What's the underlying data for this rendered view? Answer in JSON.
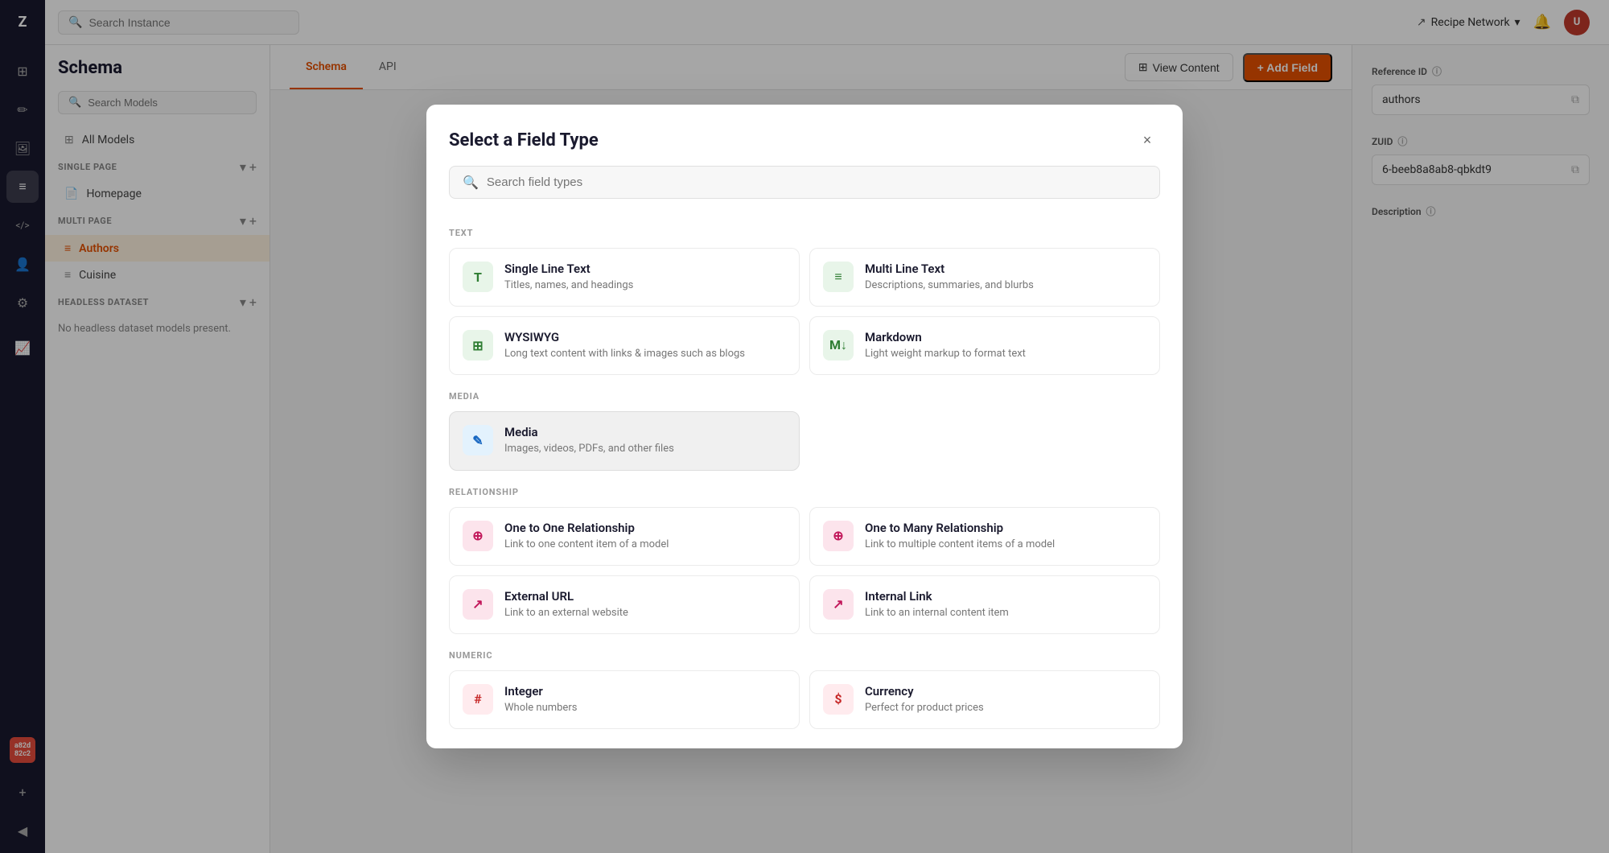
{
  "app": {
    "name": "Recipe Network",
    "logo_text": "Z"
  },
  "topbar": {
    "search_placeholder": "Search Instance",
    "recipe_network_label": "Recipe Network",
    "avatar_initials": "U"
  },
  "sidebar": {
    "schema_title": "Schema",
    "search_placeholder": "Search Models",
    "all_models_label": "All Models",
    "sections": [
      {
        "id": "single-page",
        "label": "SINGLE PAGE",
        "items": [
          {
            "id": "homepage",
            "label": "Homepage",
            "icon": "📄"
          }
        ]
      },
      {
        "id": "multi-page",
        "label": "MULTI PAGE",
        "items": [
          {
            "id": "authors",
            "label": "Authors",
            "icon": "≡",
            "active": true
          },
          {
            "id": "cuisine",
            "label": "Cuisine",
            "icon": "≡"
          }
        ]
      },
      {
        "id": "headless-dataset",
        "label": "HEADLESS DATASET",
        "items": [],
        "empty_message": "No headless dataset models present."
      }
    ]
  },
  "content_header": {
    "tabs": [
      {
        "id": "schema",
        "label": "Schema",
        "active": true
      },
      {
        "id": "api",
        "label": "API"
      }
    ],
    "view_content_label": "View Content",
    "add_field_label": "+ Add Field"
  },
  "right_panel": {
    "reference_id_label": "Reference ID",
    "reference_id_help": "?",
    "reference_id_value": "authors",
    "zuid_label": "ZUID",
    "zuid_help": "?",
    "zuid_value": "6-beeb8a8ab8-qbkdt9",
    "description_label": "Description",
    "description_help": "?"
  },
  "modal": {
    "title": "Select a Field Type",
    "search_placeholder": "Search field types",
    "close_label": "×",
    "sections": [
      {
        "id": "text",
        "label": "TEXT",
        "fields": [
          {
            "id": "single-line-text",
            "name": "Single Line Text",
            "desc": "Titles, names, and headings",
            "icon_text": "T",
            "icon_class": "green"
          },
          {
            "id": "multi-line-text",
            "name": "Multi Line Text",
            "desc": "Descriptions, summaries, and blurbs",
            "icon_text": "≡",
            "icon_class": "green"
          },
          {
            "id": "wysiwyg",
            "name": "WYSIWYG",
            "desc": "Long text content with links & images such as blogs",
            "icon_text": "⊞",
            "icon_class": "green"
          },
          {
            "id": "markdown",
            "name": "Markdown",
            "desc": "Light weight markup to format text",
            "icon_text": "M↓",
            "icon_class": "green"
          }
        ]
      },
      {
        "id": "media",
        "label": "MEDIA",
        "fields": [
          {
            "id": "media",
            "name": "Media",
            "desc": "Images, videos, PDFs, and other files",
            "icon_text": "✎",
            "icon_class": "blue",
            "highlighted": true
          }
        ]
      },
      {
        "id": "relationship",
        "label": "RELATIONSHIP",
        "fields": [
          {
            "id": "one-to-one",
            "name": "One to One Relationship",
            "desc": "Link to one content item of a model",
            "icon_text": "⊕",
            "icon_class": "pink"
          },
          {
            "id": "one-to-many",
            "name": "One to Many Relationship",
            "desc": "Link to multiple content items of a model",
            "icon_text": "⊕",
            "icon_class": "pink"
          },
          {
            "id": "external-url",
            "name": "External URL",
            "desc": "Link to an external website",
            "icon_text": "↗",
            "icon_class": "pink"
          },
          {
            "id": "internal-link",
            "name": "Internal Link",
            "desc": "Link to an internal content item",
            "icon_text": "↗",
            "icon_class": "pink"
          }
        ]
      },
      {
        "id": "numeric",
        "label": "NUMERIC",
        "fields": [
          {
            "id": "integer",
            "name": "Integer",
            "desc": "Whole numbers",
            "icon_text": "#",
            "icon_class": "red"
          },
          {
            "id": "currency",
            "name": "Currency",
            "desc": "Perfect for product prices",
            "icon_text": "$",
            "icon_class": "red"
          }
        ]
      }
    ]
  },
  "nav_icons": [
    {
      "id": "dashboard",
      "symbol": "⊞",
      "active": false
    },
    {
      "id": "content",
      "symbol": "✏",
      "active": false
    },
    {
      "id": "media",
      "symbol": "🖼",
      "active": false
    },
    {
      "id": "schema",
      "symbol": "≡",
      "active": true
    },
    {
      "id": "code",
      "symbol": "</>",
      "active": false
    },
    {
      "id": "users",
      "symbol": "👤",
      "active": false
    },
    {
      "id": "settings",
      "symbol": "⚙",
      "active": false
    },
    {
      "id": "analytics",
      "symbol": "📊",
      "active": false
    },
    {
      "id": "add",
      "symbol": "+",
      "active": false
    }
  ]
}
